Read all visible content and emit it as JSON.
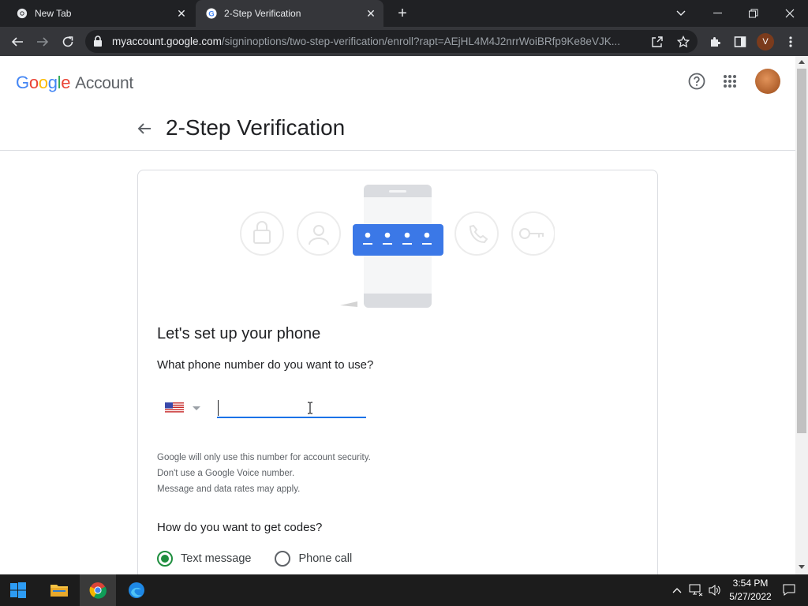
{
  "browser": {
    "tabs": [
      {
        "title": "New Tab",
        "active": false
      },
      {
        "title": "2-Step Verification",
        "active": true
      }
    ],
    "url_host": "myaccount.google.com",
    "url_path": "/signinoptions/two-step-verification/enroll?rapt=AEjHL4M4J2nrrWoiBRfp9Ke8eVJK...",
    "profile_initial": "V"
  },
  "header": {
    "logo_letters": [
      "G",
      "o",
      "o",
      "g",
      "l",
      "e"
    ],
    "logo_suffix": "Account"
  },
  "page": {
    "title": "2-Step Verification",
    "setup_heading": "Let's set up your phone",
    "phone_question": "What phone number do you want to use?",
    "phone_value": "",
    "country": "United States",
    "notes": [
      "Google will only use this number for account security.",
      "Don't use a Google Voice number.",
      "Message and data rates may apply."
    ],
    "codes_question": "How do you want to get codes?",
    "code_options": [
      {
        "label": "Text message",
        "selected": true
      },
      {
        "label": "Phone call",
        "selected": false
      }
    ]
  },
  "taskbar": {
    "time": "3:54 PM",
    "date": "5/27/2022"
  },
  "colors": {
    "accent_blue": "#1a73e8",
    "radio_green": "#1e8e3e",
    "code_box_blue": "#3b78e7"
  }
}
